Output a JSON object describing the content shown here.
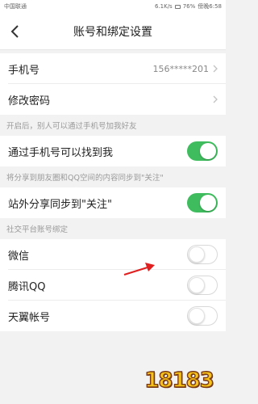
{
  "status_bar": {
    "carrier": "中国联通",
    "speed": "6.1K/s",
    "battery": "76%",
    "time": "傍晚6:58"
  },
  "header": {
    "title": "账号和绑定设置",
    "back_icon": "chevron-left-icon"
  },
  "rows": {
    "phone": {
      "label": "手机号",
      "value": "156*****201"
    },
    "change_password": {
      "label": "修改密码"
    },
    "find_by_phone": {
      "label": "通过手机号可以找到我",
      "on": true
    },
    "sync_follow": {
      "label": "站外分享同步到\"关注\"",
      "on": true
    },
    "wechat": {
      "label": "微信",
      "on": false
    },
    "qq": {
      "label": "腾讯QQ",
      "on": false
    },
    "tianyi": {
      "label": "天翼帐号",
      "on": false
    }
  },
  "notes": {
    "find_hint": "开启后，别人可以通过手机号加我好友",
    "share_hint": "将分享到朋友圈和QQ空间的内容同步到\"关注\"",
    "social_section": "社交平台账号绑定"
  },
  "colors": {
    "toggle_on": "#3fbd5e",
    "background": "#f2f2f2",
    "annotation_arrow": "#e02020"
  },
  "watermark": {
    "text": "18183"
  }
}
